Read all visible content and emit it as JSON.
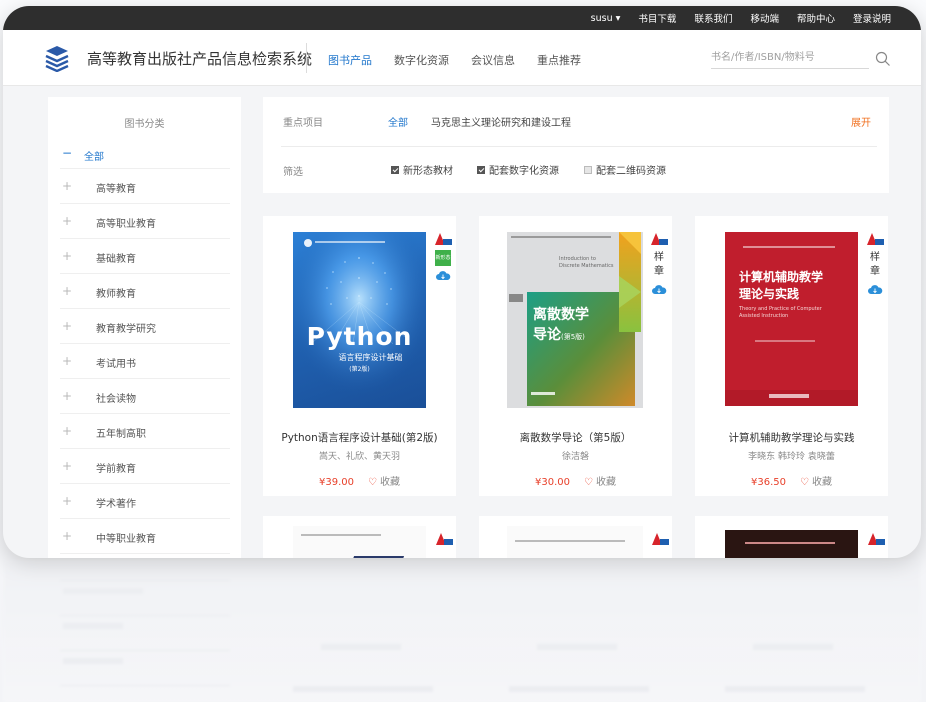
{
  "topbar": {
    "user": "susu",
    "links": [
      "书目下载",
      "联系我们",
      "移动端",
      "帮助中心",
      "登录说明"
    ]
  },
  "header": {
    "site_title": "高等教育出版社产品信息检索系统",
    "nav": [
      "图书产品",
      "数字化资源",
      "会议信息",
      "重点推荐"
    ],
    "active_nav": "图书产品",
    "search_placeholder": "书名/作者/ISBN/物料号"
  },
  "sidebar": {
    "title": "图书分类",
    "items": [
      "全部",
      "高等教育",
      "高等职业教育",
      "基础教育",
      "教师教育",
      "教育教学研究",
      "考试用书",
      "社会读物",
      "五年制高职",
      "学前教育",
      "学术著作",
      "中等职业教育"
    ]
  },
  "filter": {
    "row1_label": "重点项目",
    "all_label": "全部",
    "project": "马克思主义理论研究和建设工程",
    "expand_label": "展开",
    "row2_label": "筛选",
    "checks": [
      {
        "label": "新形态教材",
        "checked": true
      },
      {
        "label": "配套数字化资源",
        "checked": true
      },
      {
        "label": "配套二维码资源",
        "checked": false
      }
    ]
  },
  "books": [
    {
      "title": "Python语言程序设计基础(第2版)",
      "authors": "嵩天、礼欣、黄天羽",
      "price": "¥39.00",
      "fav_label": "收藏",
      "cover_title": "Python",
      "cover_subtitle": "语言程序设计基础",
      "cover_edition": "(第2版)",
      "badges": [
        "a-logo-icon",
        "new-form-icon",
        "cloud-icon"
      ],
      "badge_new_form": "新形态"
    },
    {
      "title": "离散数学导论（第5版）",
      "authors": "徐洁磐",
      "price": "¥30.00",
      "fav_label": "收藏",
      "cover_title": "离散数学",
      "cover_title2": "导论",
      "cover_edition": "(第5版)",
      "cover_en": "Introduction to Discrete Mathematics",
      "badges": [
        "a-logo-icon",
        "sample-icon",
        "cloud-icon"
      ],
      "badge_sample": "样章"
    },
    {
      "title": "计算机辅助教学理论与实践",
      "authors": "李晓东  韩玲玲  袁晓蕾",
      "price": "¥36.50",
      "fav_label": "收藏",
      "cover_title": "计算机辅助教学",
      "cover_title2": "理论与实践",
      "cover_en": "Theory and Practice of Computer Assisted Instruction",
      "badges": [
        "a-logo-icon",
        "sample-icon",
        "cloud-icon"
      ],
      "badge_sample": "样章"
    }
  ],
  "colors": {
    "accent": "#2277cc",
    "price": "#e8402a",
    "expand": "#f07020",
    "topbar": "#2e2e2e"
  }
}
